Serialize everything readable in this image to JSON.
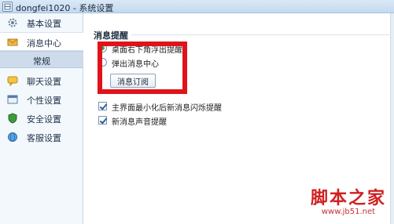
{
  "window": {
    "title": "dongfei1020 - 系统设置"
  },
  "sidebar": {
    "items": [
      {
        "label": "基本设置",
        "icon": "gear-icon"
      },
      {
        "label": "消息中心",
        "icon": "envelope-icon"
      },
      {
        "label": "聊天设置",
        "icon": "chat-bubble-icon"
      },
      {
        "label": "个性设置",
        "icon": "window-icon"
      },
      {
        "label": "安全设置",
        "icon": "shield-icon"
      },
      {
        "label": "客服设置",
        "icon": "globe-icon"
      }
    ],
    "sub_item": "常规"
  },
  "content": {
    "section_title": "消息提醒",
    "radio_options": [
      {
        "label": "桌面右下角浮出提醒",
        "checked": true
      },
      {
        "label": "弹出消息中心",
        "checked": false
      }
    ],
    "subscribe_button": "消息订阅",
    "checkboxes": [
      {
        "label": "主界面最小化后新消息闪烁提醒",
        "checked": true
      },
      {
        "label": "新消息声音提醒",
        "checked": true
      }
    ]
  },
  "watermark": {
    "main": "脚本之家",
    "url": "www.jb51.net"
  },
  "colors": {
    "highlight": "#e0131b",
    "radio_checked": "#3fa33f",
    "sidebar_bg": "#f3f8fd",
    "sub_item_bg": "#cddbea"
  }
}
